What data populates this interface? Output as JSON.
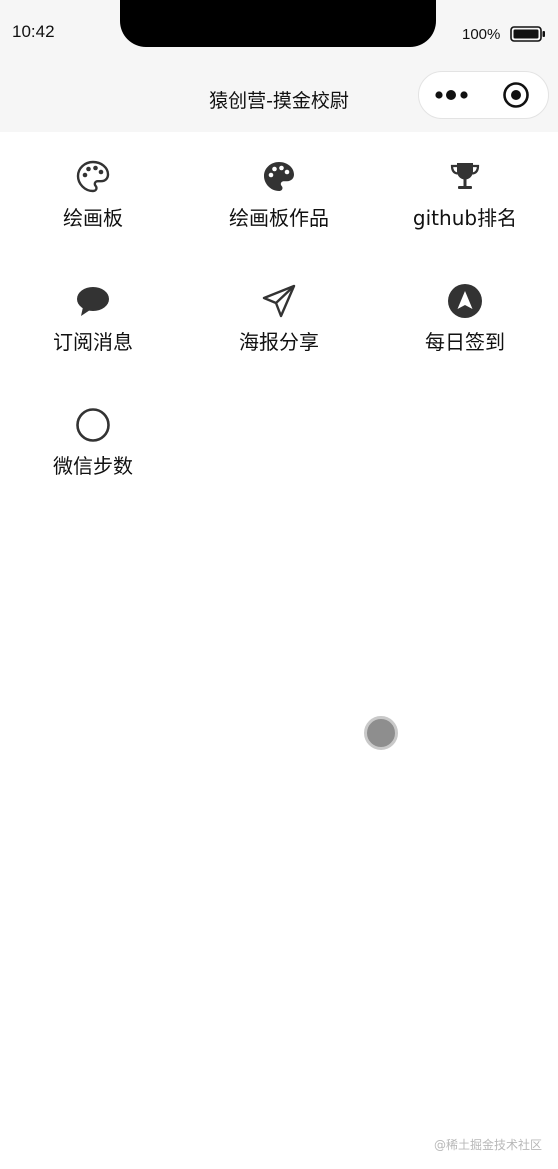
{
  "status_bar": {
    "time": "10:42",
    "battery": "100%"
  },
  "nav_bar": {
    "title": "猿创营-摸金校尉"
  },
  "grid": {
    "items": [
      {
        "label": "绘画板",
        "icon": "palette-outline-icon"
      },
      {
        "label": "绘画板作品",
        "icon": "palette-filled-icon"
      },
      {
        "label": "github排名",
        "icon": "trophy-icon"
      },
      {
        "label": "订阅消息",
        "icon": "chat-bubble-icon"
      },
      {
        "label": "海报分享",
        "icon": "paper-plane-icon"
      },
      {
        "label": "每日签到",
        "icon": "navigation-arrow-icon"
      },
      {
        "label": "微信步数",
        "icon": "circle-outline-icon"
      }
    ]
  },
  "watermark": "@稀土掘金技术社区",
  "colors": {
    "bar_background": "#f6f6f6",
    "icon": "#333333",
    "float_dot": "#8e8e8e"
  }
}
